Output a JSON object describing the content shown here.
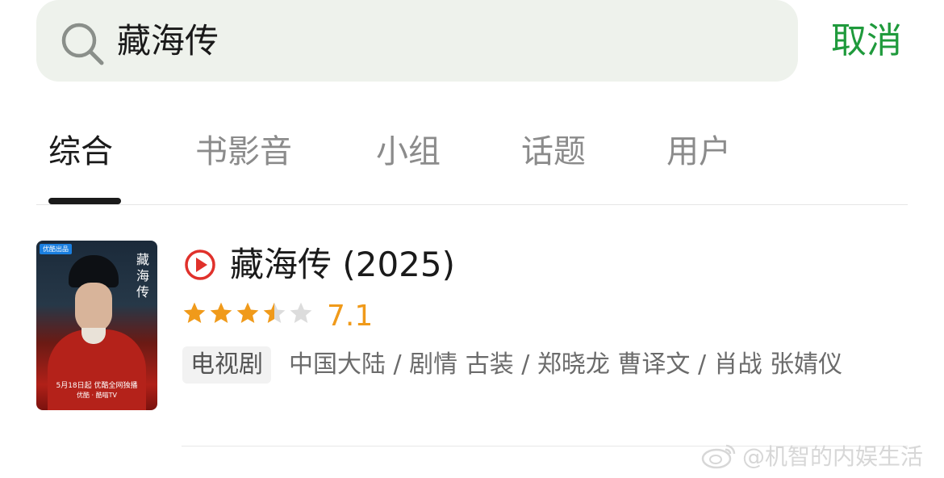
{
  "search": {
    "query": "藏海传",
    "cancel_label": "取消"
  },
  "tabs": [
    {
      "label": "综合",
      "active": true
    },
    {
      "label": "书影音",
      "active": false
    },
    {
      "label": "小组",
      "active": false
    },
    {
      "label": "话题",
      "active": false
    },
    {
      "label": "用户",
      "active": false
    }
  ],
  "result": {
    "title": "藏海传 (2025)",
    "rating": "7.1",
    "rating_stars": 3.5,
    "rating_max_stars": 5,
    "type_tag": "电视剧",
    "meta": "中国大陆 / 剧情 古装 / 郑晓龙 曹译文 / 肖战 张婧仪",
    "poster": {
      "badge": "优酷出品",
      "vertical_title": [
        "藏",
        "海",
        "传"
      ],
      "date_text": "5月18日起 优酷全网独播",
      "brand_text": "优酷 · 酷喵TV"
    }
  },
  "watermark": "@机智的内娱生活",
  "colors": {
    "accent_green": "#1f9a3c",
    "star_orange": "#f09a1a",
    "play_red": "#e0312b"
  }
}
